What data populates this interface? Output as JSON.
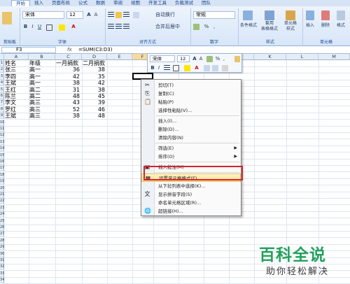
{
  "ribbon": {
    "tabs": [
      "开始",
      "插入",
      "页面布局",
      "公式",
      "数据",
      "审阅",
      "视图",
      "开发工具",
      "负载测试",
      "团队"
    ],
    "font_name": "宋体",
    "font_size": "12",
    "wrap_label": "自动换行",
    "merge_label": "合并后居中",
    "number_format": "常规",
    "percent": "%",
    "comma": ",",
    "styles": [
      {
        "line1": "条件格式",
        "line2": ""
      },
      {
        "line1": "套用",
        "line2": "表格格式"
      },
      {
        "line1": "单元格",
        "line2": "样式"
      }
    ],
    "cells_buttons": [
      "插入",
      "删除",
      "格式"
    ],
    "group_labels": {
      "clipboard": "剪贴板",
      "font": "字体",
      "align": "对齐方式",
      "number": "数字",
      "styles": "样式",
      "cells": "单元格"
    }
  },
  "formula_bar": {
    "name": "F3",
    "fx": "fx",
    "formula": "=SUM(C3:D3)"
  },
  "columns": [
    "A",
    "B",
    "C",
    "D",
    "E",
    "F",
    "G",
    "H",
    "I",
    "J",
    "K",
    "L",
    "M"
  ],
  "rows": [
    "1",
    "2",
    "3",
    "4",
    "5",
    "6",
    "7",
    "8",
    "9",
    "10",
    "11",
    "12",
    "13",
    "14",
    "15",
    "16",
    "17",
    "18",
    "19",
    "20",
    "21",
    "22",
    "23",
    "24",
    "25",
    "26",
    "27",
    "28",
    "29",
    "30",
    "31",
    "32",
    "33",
    "34"
  ],
  "table": {
    "headers": [
      "姓名",
      "年级",
      "一月捐款",
      "二月捐款"
    ],
    "rows": [
      [
        "张三",
        "高一",
        "36",
        "38"
      ],
      [
        "李四",
        "高一",
        "42",
        "35"
      ],
      [
        "王斌",
        "高一",
        "38",
        "42"
      ],
      [
        "王红",
        "高二",
        "31",
        "38"
      ],
      [
        "陈兰",
        "高二",
        "48",
        "45"
      ],
      [
        "李文",
        "高三",
        "43",
        "39"
      ],
      [
        "罗红",
        "高三",
        "52",
        "46"
      ],
      [
        "王斌",
        "高三",
        "38",
        "48"
      ]
    ]
  },
  "mini_toolbar": {
    "font": "宋体",
    "size": "12",
    "bold": "B",
    "italic": "I"
  },
  "context_menu": {
    "items": [
      {
        "label": "剪切(T)",
        "icon": "✂",
        "submenu": false
      },
      {
        "label": "复制(C)",
        "icon": "⎘",
        "submenu": false
      },
      {
        "label": "粘贴(P)",
        "icon": "📋",
        "submenu": false
      },
      {
        "label": "选择性粘贴(V)...",
        "icon": "",
        "submenu": false
      },
      {
        "label": "插入(I)...",
        "icon": "",
        "submenu": false
      },
      {
        "label": "删除(D)...",
        "icon": "",
        "submenu": false
      },
      {
        "label": "清除内容(N)",
        "icon": "",
        "submenu": false
      },
      {
        "label": "筛选(E)",
        "icon": "",
        "submenu": true
      },
      {
        "label": "排序(O)",
        "icon": "",
        "submenu": true
      },
      {
        "label": "插入批注(M)",
        "icon": "▣",
        "submenu": false
      },
      {
        "label": "设置单元格格式(F)...",
        "icon": "▦",
        "submenu": false
      },
      {
        "label": "从下拉列表中选择(K)...",
        "icon": "",
        "submenu": false
      },
      {
        "label": "显示拼音字段(S)",
        "icon": "文",
        "submenu": false
      },
      {
        "label": "命名单元格区域(R)...",
        "icon": "",
        "submenu": false
      },
      {
        "label": "超链接(H)...",
        "icon": "🌐",
        "submenu": false
      }
    ]
  },
  "watermark": {
    "line1": "百科全说",
    "line2": "助你轻松解决"
  },
  "colors": {
    "highlight": "#d9232e",
    "watermark": "#23a15a",
    "ribbon": "#d7e6f8"
  }
}
